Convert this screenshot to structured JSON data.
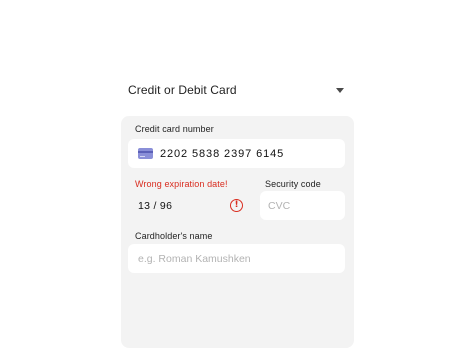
{
  "payment_method": {
    "selected_label": "Credit or Debit Card",
    "caret_icon": "caret-down-icon"
  },
  "card_form": {
    "card_number": {
      "label": "Credit card number",
      "value": "2202  5838  2397  6145",
      "icon": "credit-card-icon"
    },
    "expiration": {
      "error_label": "Wrong expiration date!",
      "value": "13 / 96",
      "error_icon": "error-exclamation-icon"
    },
    "security_code": {
      "label": "Security code",
      "placeholder": "CVC"
    },
    "cardholder_name": {
      "label": "Cardholder's name",
      "placeholder": "e.g. Roman Kamushken"
    }
  },
  "colors": {
    "panel_bg": "#f3f3f3",
    "error": "#d92d20",
    "card_icon": "#8a8fd8"
  }
}
